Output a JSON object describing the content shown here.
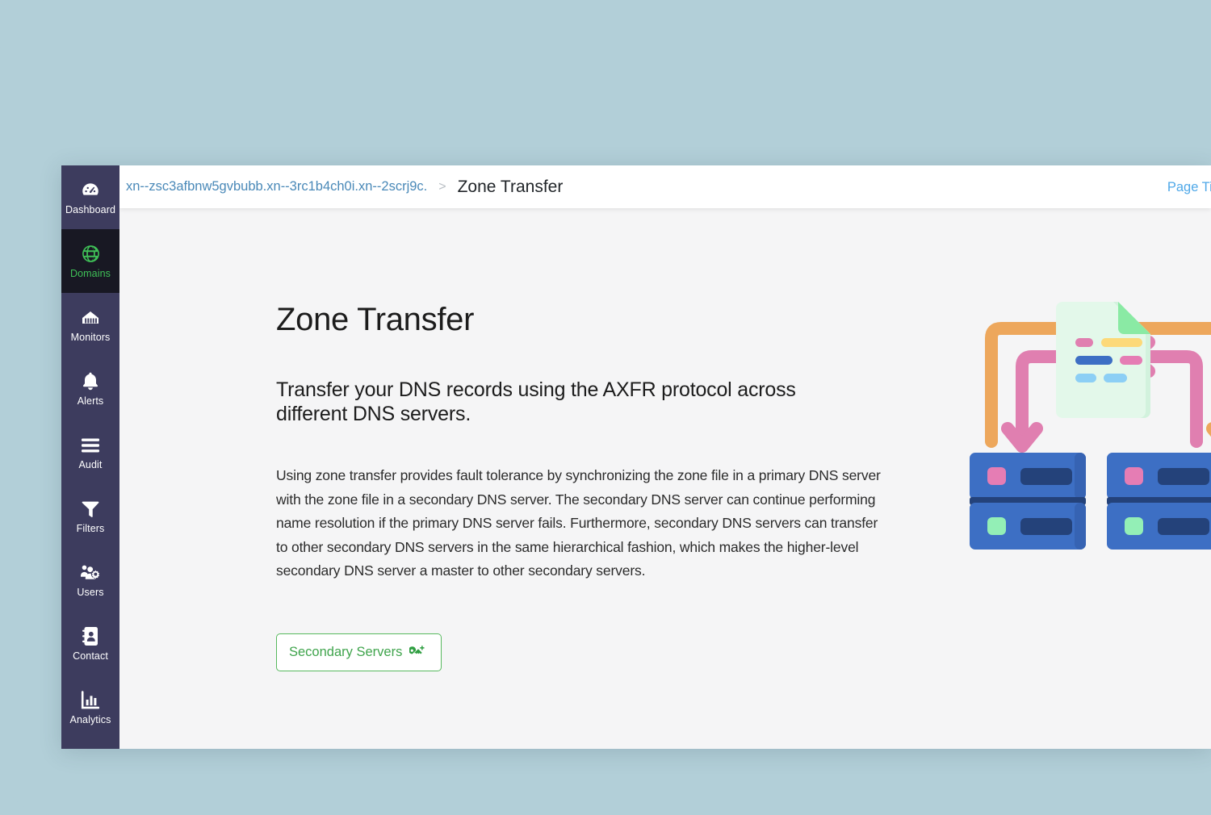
{
  "window": {
    "sidebar": {
      "items": [
        {
          "label": "Dashboard",
          "icon": "gauge-icon",
          "active": false
        },
        {
          "label": "Domains",
          "icon": "globe-icon",
          "active": true
        },
        {
          "label": "Monitors",
          "icon": "network-icon",
          "active": false
        },
        {
          "label": "Alerts",
          "icon": "bell-icon",
          "active": false
        },
        {
          "label": "Audit",
          "icon": "list-icon",
          "active": false
        },
        {
          "label": "Filters",
          "icon": "funnel-icon",
          "active": false
        },
        {
          "label": "Users",
          "icon": "users-gear-icon",
          "active": false
        },
        {
          "label": "Contact",
          "icon": "contact-book-icon",
          "active": false
        },
        {
          "label": "Analytics",
          "icon": "bar-chart-icon",
          "active": false
        }
      ]
    },
    "topbar": {
      "breadcrumb": {
        "parent": "xn--zsc3afbnw5gvbubb.xn--3rc1b4ch0i.xn--2scrj9c.",
        "separator": ">",
        "current": "Zone Transfer"
      },
      "page_tip": "Page Tip"
    },
    "main": {
      "title": "Zone Transfer",
      "subtitle": "Transfer your DNS records using the AXFR protocol across different DNS servers.",
      "body": "Using zone transfer provides fault tolerance by synchronizing the zone file in a primary DNS server with the zone file in a secondary DNS server. The secondary DNS server can continue performing name resolution if the primary DNS server fails. Furthermore, secondary DNS servers can transfer to other secondary DNS servers in the same hierarchical fashion, which makes the higher-level secondary DNS server a master to other secondary servers.",
      "cta": {
        "label": "Secondary Servers",
        "icon": "key-plus-icon"
      },
      "illustration": {
        "name": "zone-transfer-illustration",
        "elements": [
          "document",
          "orange-arrow-left",
          "pink-arrow-left",
          "orange-arrow-right",
          "pink-arrow-right",
          "server-primary",
          "server-secondary"
        ]
      }
    }
  },
  "colors": {
    "page_background": "#b2cfd8",
    "sidebar": "#3d3c5e",
    "sidebar_active": "#181823",
    "accent_green": "#3fc057",
    "link_blue": "#4a89b8",
    "tip_blue": "#4fa8e8",
    "content_background": "#f5f5f6",
    "illustration_orange": "#eda75c",
    "illustration_pink": "#e07fb0",
    "illustration_blue": "#3d6fc4",
    "illustration_dark_blue": "#24427a",
    "illustration_green": "#e3f8ea"
  }
}
